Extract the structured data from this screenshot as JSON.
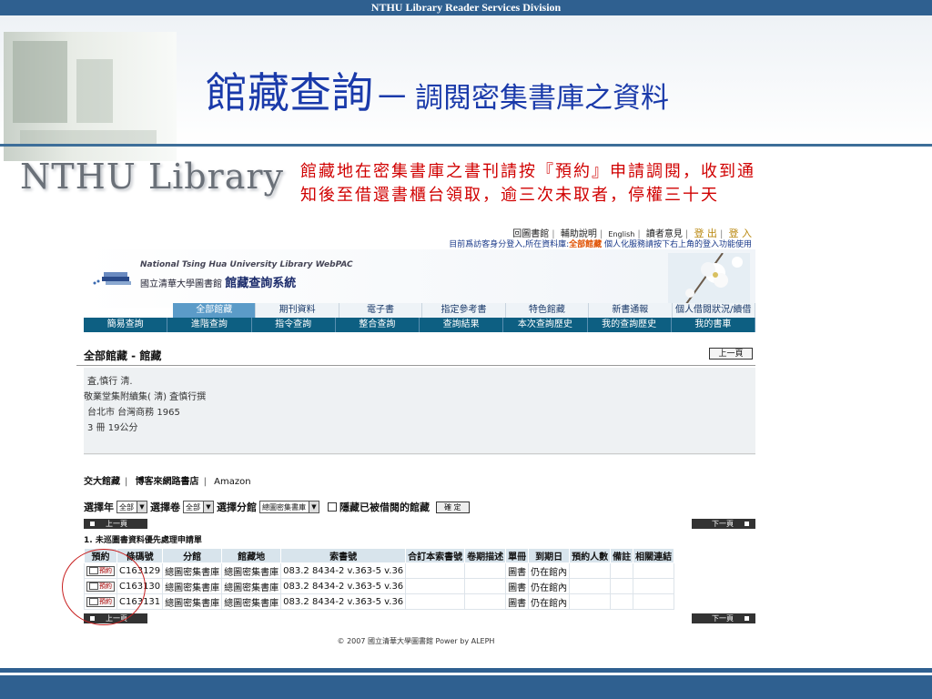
{
  "slide": {
    "header": "NTHU Library Reader Services Division",
    "title_main": "館藏查詢",
    "title_sub": "一 調閱密集書庫之資料",
    "logo_text": "NTHU Library",
    "note_line1": "館藏地在密集書庫之書刊請按『預約』申請調閱，收到通",
    "note_line2": "知後至借還書櫃台領取，逾三次未取者，停權三十天",
    "circle_color": "#c82020",
    "note_color": "#d00000",
    "title_color": "#1a3aaa"
  },
  "opac": {
    "top_links": [
      "回圖書館",
      "輔助說明",
      "English",
      "讀者意見",
      "登 出",
      "登 入"
    ],
    "top_note_pre": "目前爲訪客身分登入,所在資料庫:",
    "top_note_db": "全部館藏",
    "top_note_post": " 個人化服務請按下右上角的登入功能使用",
    "logo_en": "National Tsing Hua University Library WebPAC",
    "logo_zh_small": "國立清華大學圖書館 ",
    "logo_zh_big": "館藏查詢系統",
    "tabs": [
      "全部館藏",
      "期刊資料",
      "電子書",
      "指定參考書",
      "特色館藏",
      "新書通報",
      "個人借閱狀況/續借"
    ],
    "subnav": [
      "簡易查詢",
      "進階查詢",
      "指令查詢",
      "整合查詢",
      "查詢結果",
      "本次查詢歷史",
      "我的查詢歷史",
      "我的書車"
    ],
    "section_title": "全部館藏 - 館藏",
    "prev_page": "上一頁",
    "next_page": "下一頁",
    "record": {
      "line1": "査,慎行 淸.",
      "line2": "敬業堂集附續集( 淸) 査慎行撰",
      "line3": "台北市 台灣商務 1965",
      "line4": "3 冊 19公分"
    },
    "ext_links": [
      "交大館藏",
      "博客來網路書店",
      "Amazon"
    ],
    "select_year_label": "選擇年",
    "select_year_value": "全部",
    "select_vol_label": "選擇卷",
    "select_vol_value": "全部",
    "select_branch_label": "選擇分館",
    "select_branch_value": "總圖密集書庫",
    "hide_borrowed_label": "隱藏已被借閱的館藏",
    "ok_label": "確 定",
    "unprocessed": "1. 未巡圖書資料優先處理申請單",
    "columns": [
      "預約",
      "條碼號",
      "分館",
      "館藏地",
      "索書號",
      "合訂本索書號",
      "卷期描述",
      "單冊",
      "到期日",
      "預約人數",
      "備註",
      "相關連結"
    ],
    "reserve_label": "預約",
    "items": [
      {
        "barcode": "C163129",
        "branch": "總圖密集書庫",
        "location": "總圖密集書庫",
        "call": "083.2 8434-2 v.363-5 v.36",
        "type": "圖書",
        "status": "仍在館內"
      },
      {
        "barcode": "C163130",
        "branch": "總圖密集書庫",
        "location": "總圖密集書庫",
        "call": "083.2 8434-2 v.363-5 v.36",
        "type": "圖書",
        "status": "仍在館內"
      },
      {
        "barcode": "C163131",
        "branch": "總圖密集書庫",
        "location": "總圖密集書庫",
        "call": "083.2 8434-2 v.363-5 v.36",
        "type": "圖書",
        "status": "仍在館內"
      }
    ],
    "footer": "© 2007 國立清華大學圖書館 Power by ALEPH"
  }
}
